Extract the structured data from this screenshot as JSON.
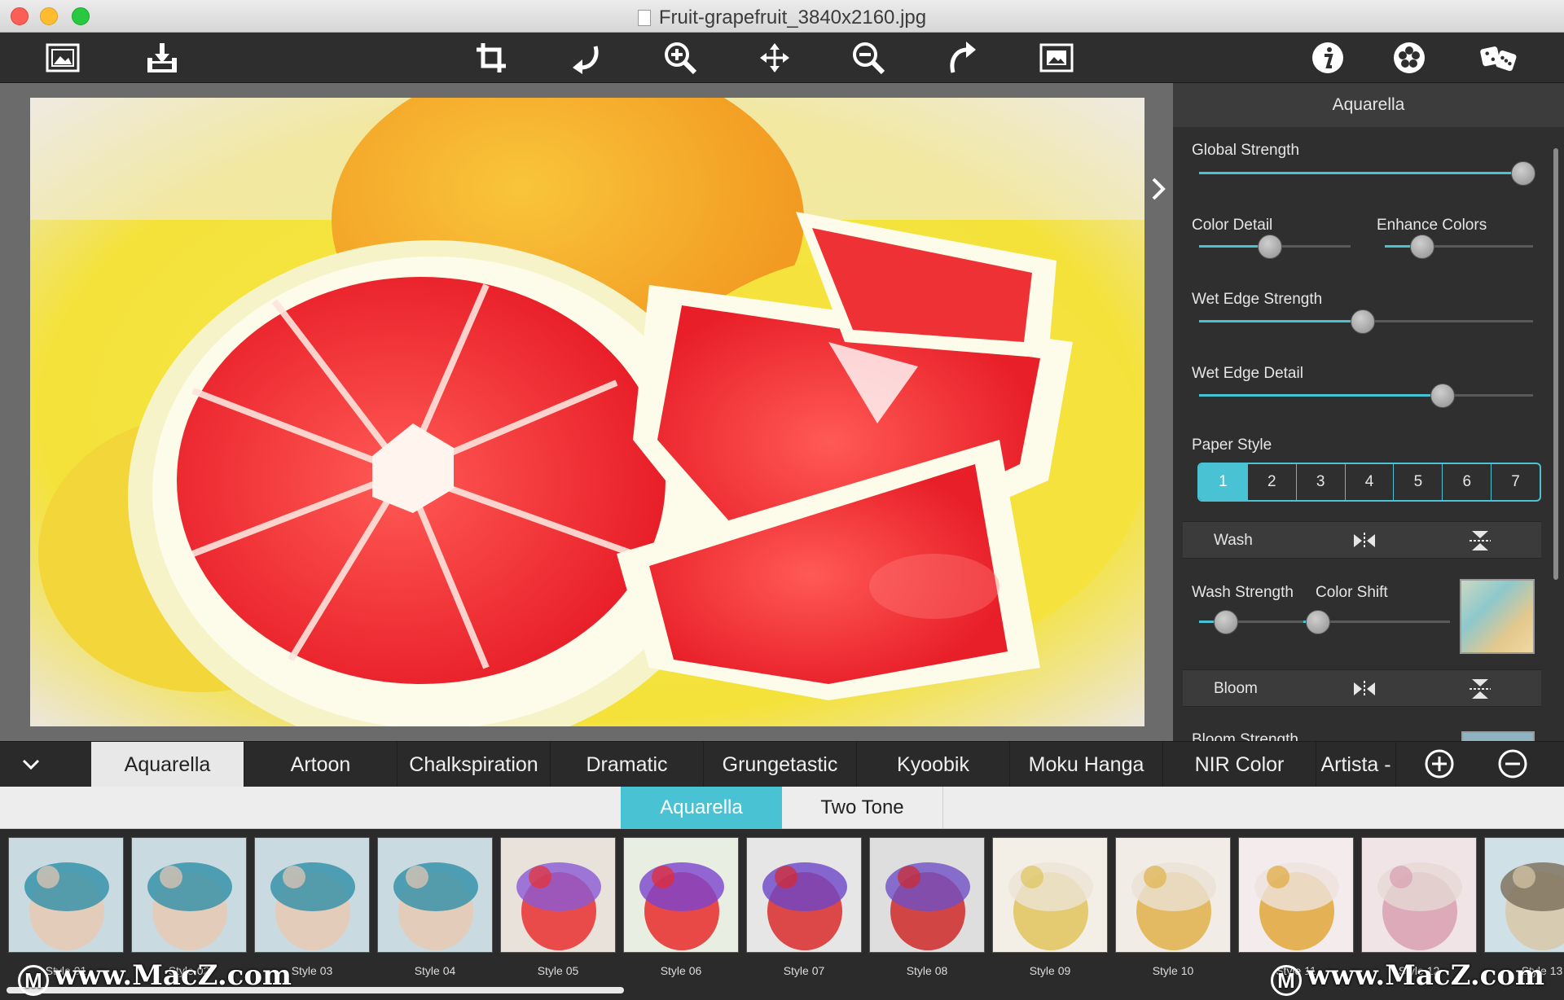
{
  "window": {
    "title": "Fruit-grapefruit_3840x2160.jpg"
  },
  "toolbar": {
    "left": [
      "open-image-icon",
      "save-export-icon"
    ],
    "center": [
      "crop-icon",
      "undo-icon",
      "zoom-in-icon",
      "pan-move-icon",
      "zoom-out-icon",
      "redo-icon",
      "fit-image-icon"
    ],
    "right": [
      "info-icon",
      "settings-flower-icon",
      "randomize-dice-icon"
    ]
  },
  "panel": {
    "title": "Aquarella",
    "global_strength": {
      "label": "Global Strength",
      "value": 0.97
    },
    "color_detail": {
      "label": "Color Detail",
      "value": 0.47
    },
    "enhance_colors": {
      "label": "Enhance Colors",
      "value": 0.25
    },
    "wet_edge_strength": {
      "label": "Wet Edge Strength",
      "value": 0.49
    },
    "wet_edge_detail": {
      "label": "Wet Edge Detail",
      "value": 0.73
    },
    "paper_style": {
      "label": "Paper Style",
      "options": [
        "1",
        "2",
        "3",
        "4",
        "5",
        "6",
        "7"
      ],
      "selected": "1"
    },
    "wash": {
      "label": "Wash"
    },
    "wash_strength": {
      "label": "Wash Strength",
      "value": 0.25
    },
    "color_shift": {
      "label": "Color Shift",
      "value": 0.1
    },
    "bloom": {
      "label": "Bloom"
    },
    "bloom_strength": {
      "label": "Bloom Strength"
    }
  },
  "tabs": {
    "items": [
      "Aquarella",
      "Artoon",
      "Chalkspiration",
      "Dramatic",
      "Grungetastic",
      "Kyoobik",
      "Moku Hanga",
      "NIR Color",
      "Artista -"
    ],
    "active": "Aquarella"
  },
  "subtabs": {
    "items": [
      "Aquarella",
      "Two Tone"
    ],
    "active": "Aquarella"
  },
  "styles": [
    "Style 01",
    "Style 02",
    "Style 03",
    "Style 04",
    "Style 05",
    "Style 06",
    "Style 07",
    "Style 08",
    "Style 09",
    "Style 10",
    "Style 11",
    "Style 12",
    "Style 13"
  ],
  "watermark": {
    "text": "www.MacZ.com",
    "logo": "M"
  },
  "colors": {
    "accent": "#49c2d3",
    "panel_bg": "#2f2f2f",
    "toolbar_bg": "#2e2e2e"
  }
}
